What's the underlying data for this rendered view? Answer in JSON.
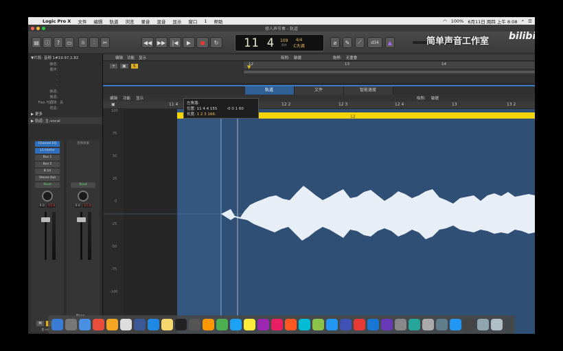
{
  "menubar": {
    "app_name": "Logic Pro X",
    "items": [
      "文件",
      "编辑",
      "轨道",
      "浏览",
      "录音",
      "混音",
      "显示",
      "窗口",
      "1",
      "帮助"
    ],
    "battery": "100%",
    "datetime": "6月11日 周四 上午 8:08"
  },
  "window": {
    "title": "修人声节奏 - 轨道"
  },
  "lcd": {
    "position": "11 4",
    "tempo": "109",
    "tempo_label": "保持",
    "signature": "4/4",
    "key": "C大调"
  },
  "toolbar": {
    "input_value": "d34"
  },
  "watermark": {
    "text": "简单声音工作室",
    "logo_text": "bilibili"
  },
  "inspector": {
    "region_header": "▼片段: 音频 1#19.97,1.82",
    "kv": [
      {
        "k": "静音:",
        "v": ""
      },
      {
        "k": "循环:",
        "v": ""
      },
      {
        "k": "-",
        "v": ""
      },
      {
        "k": "-",
        "v": ""
      },
      {
        "k": "-",
        "v": ""
      },
      {
        "k": "移调:",
        "v": ""
      },
      {
        "k": "微调:",
        "v": ""
      },
      {
        "k": "Flex 与跟随:",
        "v": "关"
      },
      {
        "k": "增益:",
        "v": ""
      }
    ],
    "more_label": "▶ 更多",
    "track_header": "▶ 轨道:  主-vocal",
    "strip1": {
      "plugins": [
        "Channel EQ",
        "L1 limiter"
      ],
      "sends": [
        "Bus 1",
        "Bus 2",
        "B 14"
      ],
      "output": "Stereo Out",
      "auto": "Read",
      "vol": "0.0",
      "peak": "-15.9",
      "mute": "M",
      "solo": "S",
      "name": "主-vocal"
    },
    "strip2": {
      "label": "音频效果",
      "auto": "Read",
      "vol": "0.0",
      "peak": "-15.9",
      "mute": "M",
      "solo": "S",
      "name": "Stereo Out",
      "bnce": "Bnce"
    }
  },
  "tracks_bar": {
    "items": [
      "编辑",
      "功能",
      "显示"
    ],
    "snap_label": "吸附:",
    "snap_value": "敏捷",
    "drag_label": "拖移:",
    "drag_value": "无重叠"
  },
  "ruler_top": [
    "12",
    "13",
    "14"
  ],
  "editor": {
    "tabs": [
      "轨道",
      "文件",
      "智能速度"
    ],
    "bar_items": [
      "编辑",
      "功能",
      "显示"
    ],
    "snap_label": "吸附:",
    "snap_value": "敏捷",
    "ruler": [
      "11 4",
      "12",
      "12 2",
      "12 3",
      "12 4",
      "13",
      "13 2"
    ],
    "region_label": "12",
    "y_ticks": [
      "100",
      "75",
      "50",
      "25",
      "0",
      "-25",
      "-50",
      "-75",
      "-100"
    ]
  },
  "tooltip": {
    "title": "左角落:",
    "pos_label": "位置:",
    "pos_value": "11 4 4 155",
    "offset": "-0 0 1 60",
    "len_label": "长度:",
    "len_value": "1 2 3 166."
  },
  "dock": {
    "colors": [
      "#3a7bd5",
      "#777",
      "#4a90e2",
      "#e94e3c",
      "#f5a623",
      "#ddd",
      "#3b5998",
      "#1e88e5",
      "#f5d76e",
      "#222",
      "#555",
      "#ff9800",
      "#4caf50",
      "#1da1f2",
      "#ffeb3b",
      "#9c27b0",
      "#e91e63",
      "#ff5722",
      "#00bcd4",
      "#8bc34a",
      "#2196f3",
      "#3f51b5",
      "#e53935",
      "#1976d2",
      "#673ab7",
      "#888",
      "#26a69a",
      "#aaa",
      "#607d8b",
      "#2196f3",
      "#444",
      "#90a4ae",
      "#b0bec5"
    ]
  }
}
